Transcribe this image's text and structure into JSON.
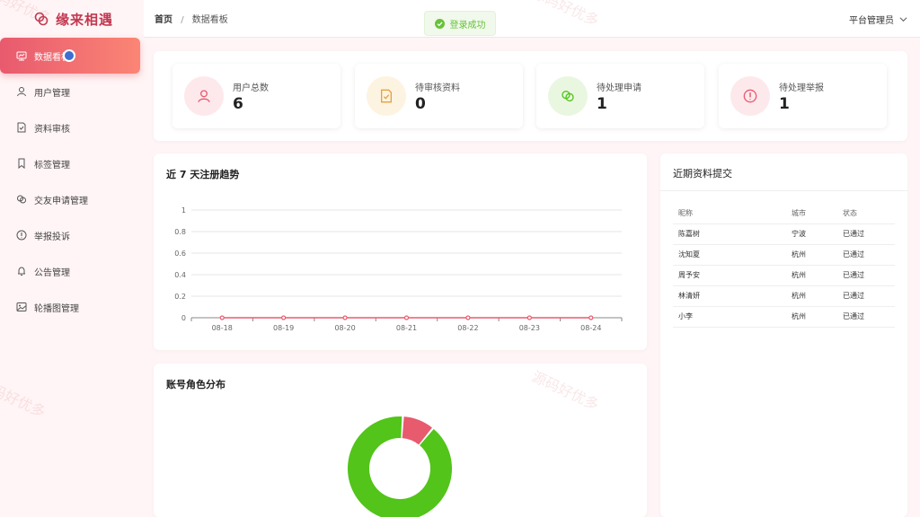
{
  "brand": {
    "name": "缘来相遇"
  },
  "sidebar": {
    "items": [
      {
        "label": "数据看板",
        "icon": "dashboard-icon",
        "active": true
      },
      {
        "label": "用户管理",
        "icon": "user-icon"
      },
      {
        "label": "资料审核",
        "icon": "doc-check-icon"
      },
      {
        "label": "标签管理",
        "icon": "bookmark-icon"
      },
      {
        "label": "交友申请管理",
        "icon": "link-icon"
      },
      {
        "label": "举报投诉",
        "icon": "alert-icon"
      },
      {
        "label": "公告管理",
        "icon": "bell-icon"
      },
      {
        "label": "轮播图管理",
        "icon": "image-icon"
      }
    ]
  },
  "header": {
    "breadcrumb_home": "首页",
    "breadcrumb_sep": "/",
    "breadcrumb_current": "数据看板",
    "user": "平台管理员"
  },
  "toast": {
    "text": "登录成功"
  },
  "stats": [
    {
      "label": "用户总数",
      "value": "6",
      "icon": "user-icon",
      "color": "#e85a6e",
      "bg": "#fde9ec"
    },
    {
      "label": "待审核资料",
      "value": "0",
      "icon": "doc-check-icon",
      "color": "#e6a23c",
      "bg": "#fdf3e1"
    },
    {
      "label": "待处理申请",
      "value": "1",
      "icon": "link-icon",
      "color": "#52c41a",
      "bg": "#e9f7e1"
    },
    {
      "label": "待处理举报",
      "value": "1",
      "icon": "alert-icon",
      "color": "#e85a6e",
      "bg": "#fde9ec"
    }
  ],
  "trend": {
    "title": "近 7 天注册趋势"
  },
  "chart_data": {
    "type": "line",
    "x": [
      "08-18",
      "08-19",
      "08-20",
      "08-21",
      "08-22",
      "08-23",
      "08-24"
    ],
    "series": [
      {
        "values": [
          0,
          0,
          0,
          0,
          0,
          0,
          0
        ]
      }
    ],
    "yticks": [
      "0",
      "0.2",
      "0.4",
      "0.6",
      "0.8",
      "1"
    ],
    "ylim": [
      0,
      1
    ],
    "grid": true,
    "color": "#e85a6e"
  },
  "recent": {
    "title": "近期资料提交",
    "columns": [
      "昵称",
      "城市",
      "状态"
    ],
    "rows": [
      [
        "陈嘉树",
        "宁波",
        "已通过"
      ],
      [
        "沈知夏",
        "杭州",
        "已通过"
      ],
      [
        "周予安",
        "杭州",
        "已通过"
      ],
      [
        "林清妍",
        "杭州",
        "已通过"
      ],
      [
        "小李",
        "杭州",
        "已通过"
      ]
    ]
  },
  "roles": {
    "title": "账号角色分布",
    "slices": [
      {
        "value": 0.9,
        "color": "#52c41a"
      },
      {
        "value": 0.1,
        "color": "#e85a6e"
      }
    ]
  },
  "watermark": "源码好优多"
}
